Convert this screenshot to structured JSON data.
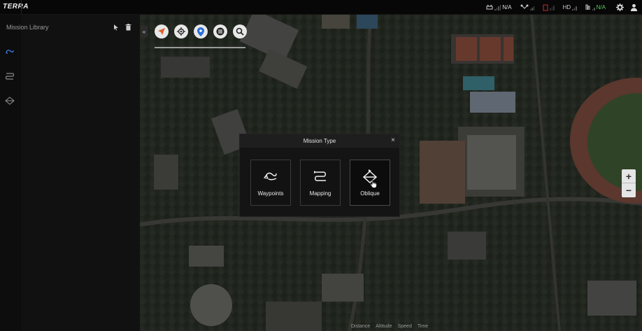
{
  "app": {
    "name": "TERRA"
  },
  "status": {
    "signal1": "N/A",
    "video": "HD",
    "signal2": "N/A",
    "colors": {
      "na_green": "#5cc95c",
      "battery_red": "#d03030"
    }
  },
  "library": {
    "title": "Mission Library",
    "icons": [
      "import-icon",
      "delete-icon"
    ],
    "rail": [
      "waypoints-mission-icon",
      "mapping-mission-icon",
      "oblique-mission-icon"
    ]
  },
  "map_toolbar": [
    "compass-icon",
    "locate-icon",
    "pin-icon",
    "list-icon",
    "search-icon"
  ],
  "zoom": {
    "in": "+",
    "out": "−"
  },
  "bottom_stats": [
    "Distance",
    "Altitude",
    "Speed",
    "Time"
  ],
  "dialog": {
    "title": "Mission Type",
    "close": "×",
    "options": [
      {
        "label": "Waypoints",
        "icon": "waypoints-icon"
      },
      {
        "label": "Mapping",
        "icon": "mapping-icon"
      },
      {
        "label": "Oblique",
        "icon": "oblique-icon",
        "state": "hover"
      }
    ]
  }
}
